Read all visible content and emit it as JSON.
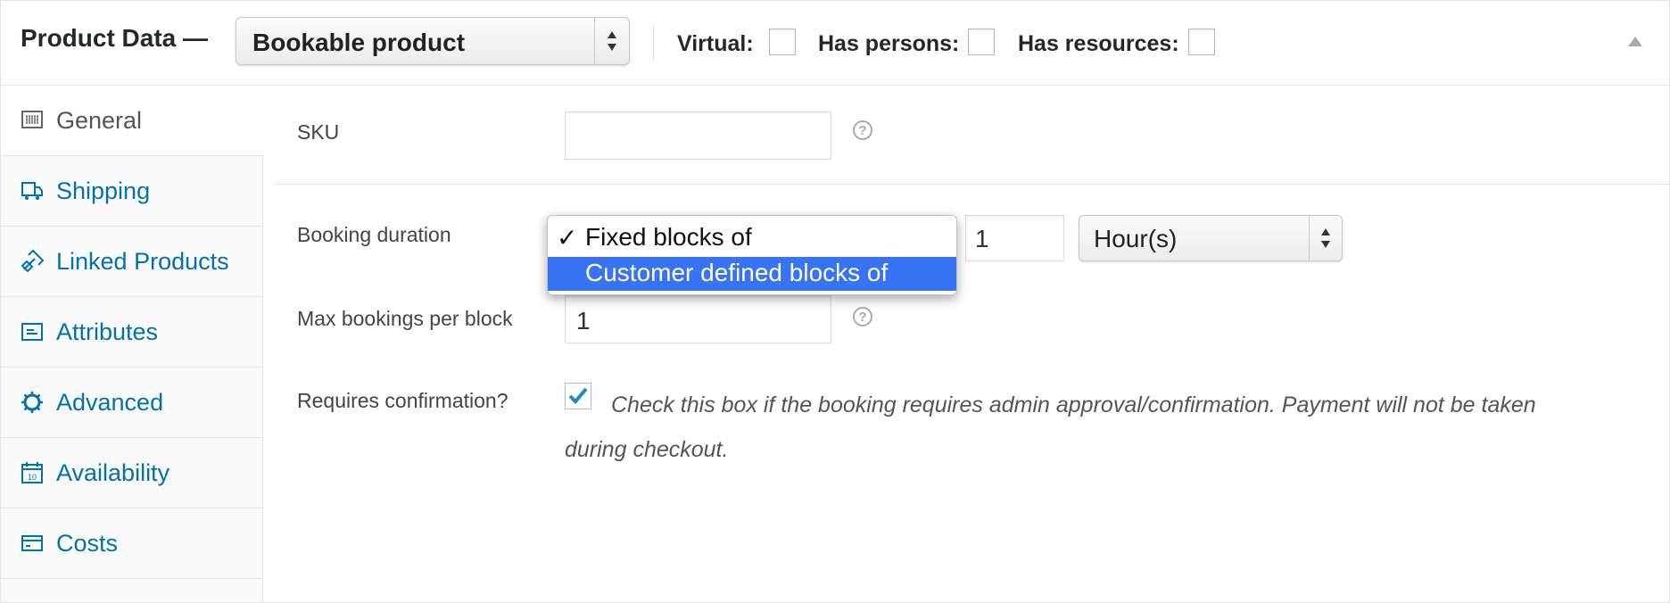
{
  "header": {
    "title": "Product Data —",
    "product_type": "Bookable product",
    "virtual_label": "Virtual:",
    "has_persons_label": "Has persons:",
    "has_resources_label": "Has resources:"
  },
  "sidebar": {
    "items": [
      {
        "label": "General",
        "icon": "barcode-icon",
        "active": true
      },
      {
        "label": "Shipping",
        "icon": "truck-icon"
      },
      {
        "label": "Linked Products",
        "icon": "link-icon"
      },
      {
        "label": "Attributes",
        "icon": "attributes-icon"
      },
      {
        "label": "Advanced",
        "icon": "gear-icon"
      },
      {
        "label": "Availability",
        "icon": "calendar-icon"
      },
      {
        "label": "Costs",
        "icon": "card-icon"
      }
    ]
  },
  "main": {
    "sku_label": "SKU",
    "sku_value": "",
    "booking_duration_label": "Booking duration",
    "duration_options": [
      "Fixed blocks of",
      "Customer defined blocks of"
    ],
    "duration_check": "✓",
    "duration_value": "1",
    "duration_unit": "Hour(s)",
    "max_bookings_label": "Max bookings per block",
    "max_bookings_value": "1",
    "requires_confirmation_label": "Requires confirmation?",
    "requires_confirmation_desc": "Check this box if the booking requires admin approval/confirmation. Payment will not be taken during checkout.",
    "help_glyph": "?"
  },
  "colors": {
    "link": "#0073aa",
    "highlight": "#3874f2",
    "check": "#1e8cbe"
  }
}
